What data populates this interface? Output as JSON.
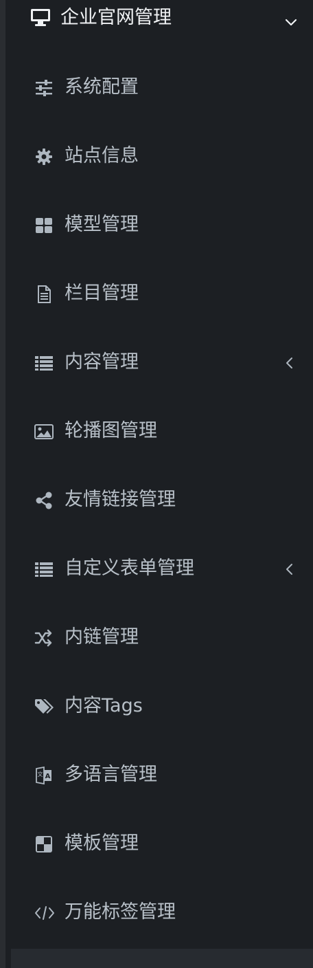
{
  "sidebar": {
    "group": {
      "label": "企业官网管理",
      "icon": "monitor-icon",
      "expanded": true
    },
    "items": [
      {
        "label": "系统配置",
        "icon": "sliders-icon"
      },
      {
        "label": "站点信息",
        "icon": "gear-icon"
      },
      {
        "label": "模型管理",
        "icon": "grid-icon"
      },
      {
        "label": "栏目管理",
        "icon": "document-icon"
      },
      {
        "label": "内容管理",
        "icon": "list-icon",
        "has_submenu": true
      },
      {
        "label": "轮播图管理",
        "icon": "image-icon"
      },
      {
        "label": "友情链接管理",
        "icon": "share-icon"
      },
      {
        "label": "自定义表单管理",
        "icon": "list-icon",
        "has_submenu": true
      },
      {
        "label": "内链管理",
        "icon": "shuffle-icon"
      },
      {
        "label": "内容Tags",
        "icon": "tags-icon"
      },
      {
        "label": "多语言管理",
        "icon": "language-icon"
      },
      {
        "label": "模板管理",
        "icon": "template-icon"
      },
      {
        "label": "万能标签管理",
        "icon": "code-icon"
      }
    ]
  },
  "colors": {
    "background": "#1c1f23",
    "group_text": "#f0f2f4",
    "item_text": "#b8c0c8",
    "icon": "#aeb7c0"
  }
}
